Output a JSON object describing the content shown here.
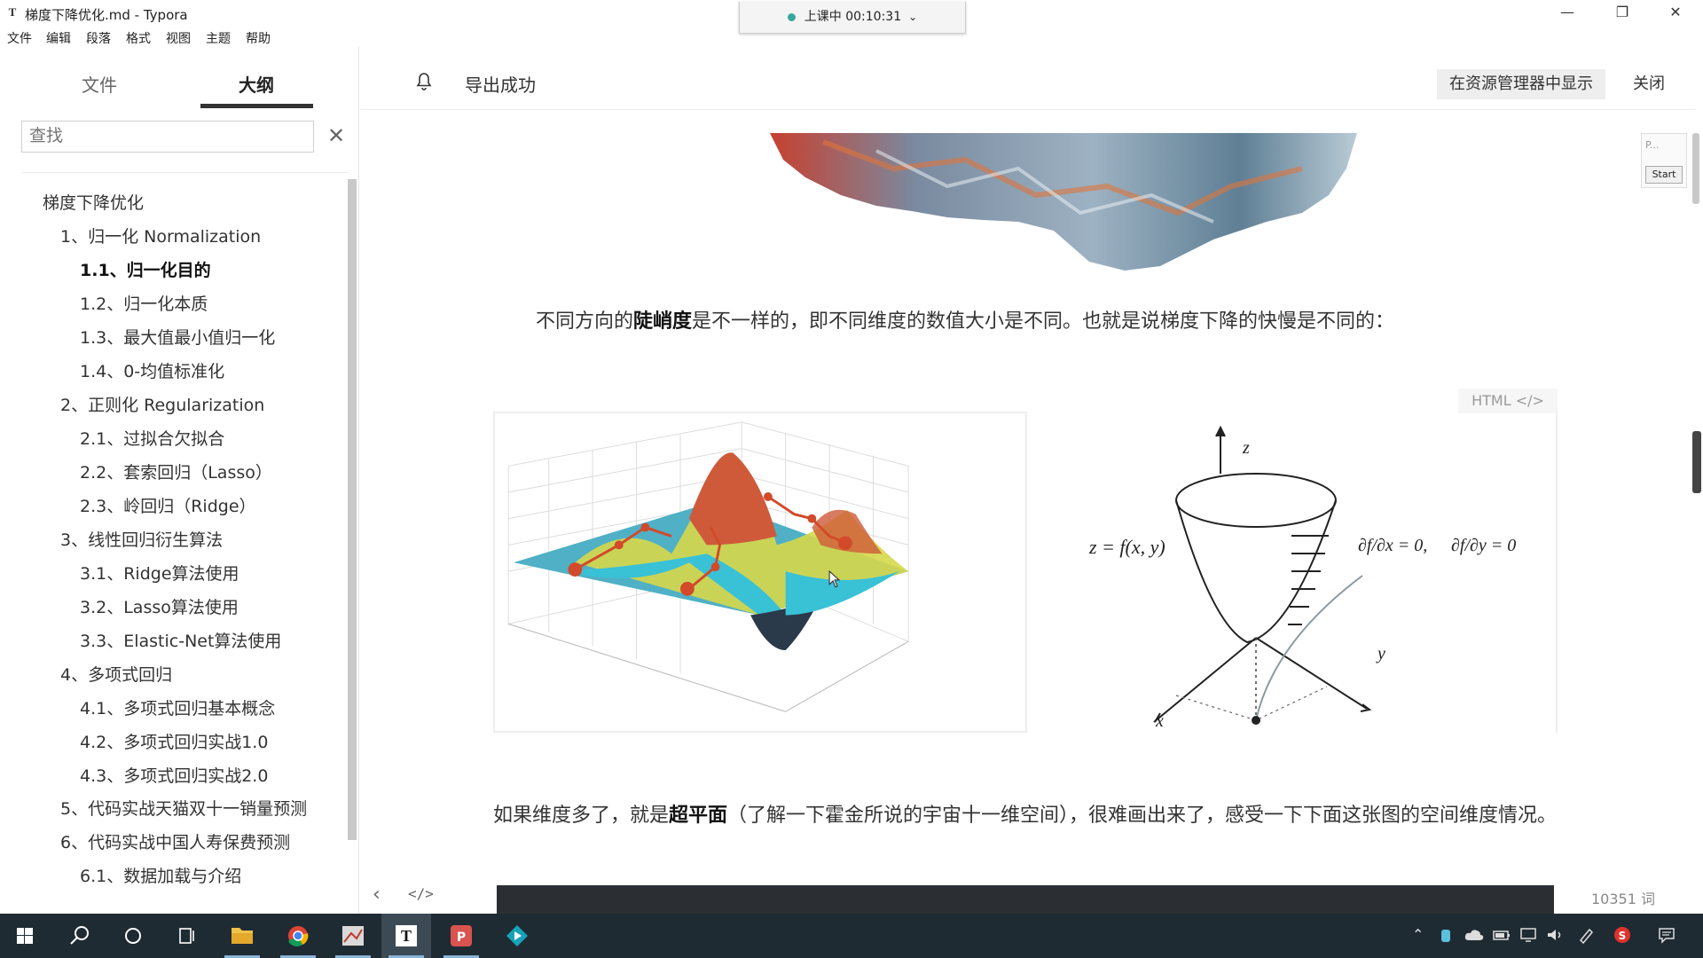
{
  "window": {
    "app_icon": "T",
    "title": "梯度下降优化.md - Typora",
    "minimize": "—",
    "maximize": "❐",
    "close": "✕"
  },
  "session": {
    "label": "上课中 00:10:31",
    "chevron": "⌄"
  },
  "menu": [
    "文件",
    "编辑",
    "段落",
    "格式",
    "视图",
    "主题",
    "帮助"
  ],
  "sidebar": {
    "tabs": [
      {
        "label": "文件"
      },
      {
        "label": "大纲"
      }
    ],
    "search_placeholder": "查找",
    "close_icon": "✕",
    "outline": [
      {
        "label": "梯度下降优化",
        "level": 1
      },
      {
        "label": "1、归一化 Normalization",
        "level": 2
      },
      {
        "label": "1.1、归一化目的",
        "level": 3,
        "active": true
      },
      {
        "label": "1.2、归一化本质",
        "level": 3
      },
      {
        "label": "1.3、最大值最小值归一化",
        "level": 3
      },
      {
        "label": "1.4、0-均值标准化",
        "level": 3
      },
      {
        "label": "2、正则化 Regularization",
        "level": 2
      },
      {
        "label": "2.1、过拟合欠拟合",
        "level": 3
      },
      {
        "label": "2.2、套索回归（Lasso）",
        "level": 3
      },
      {
        "label": "2.3、岭回归（Ridge）",
        "level": 3
      },
      {
        "label": "3、线性回归衍生算法",
        "level": 2
      },
      {
        "label": "3.1、Ridge算法使用",
        "level": 3
      },
      {
        "label": "3.2、Lasso算法使用",
        "level": 3
      },
      {
        "label": "3.3、Elastic-Net算法使用",
        "level": 3
      },
      {
        "label": "4、多项式回归",
        "level": 2
      },
      {
        "label": "4.1、多项式回归基本概念",
        "level": 3
      },
      {
        "label": "4.2、多项式回归实战1.0",
        "level": 3
      },
      {
        "label": "4.3、多项式回归实战2.0",
        "level": 3
      },
      {
        "label": "5、代码实战天猫双十一销量预测",
        "level": 2,
        "wrap": true
      },
      {
        "label": "6、代码实战中国人寿保费预测",
        "level": 2
      },
      {
        "label": "6.1、数据加载与介绍",
        "level": 3
      }
    ]
  },
  "notification": {
    "message": "导出成功",
    "show_in_explorer": "在资源管理器中显示",
    "close": "关闭"
  },
  "content": {
    "para1": {
      "before": "不同方向的",
      "bold": "陡峭度",
      "after": "是不一样的，即不同维度的数值大小是不同。也就是说梯度下降的快慢是不同的："
    },
    "html_tag": "HTML </>",
    "figure_right": {
      "formula_left": "z = f(x, y)",
      "partial_x": "∂f/∂x = 0,",
      "partial_y": "∂f/∂y = 0",
      "axis_z": "z",
      "axis_x": "x",
      "axis_y": "y"
    },
    "para2": {
      "before": "如果维度多了，就是",
      "bold": "超平面",
      "after": "（了解一下霍金所说的宇宙十一维空间），很难画出来了，感受一下下面这张图的空间维度情况。"
    }
  },
  "mini_panel": {
    "label": "P...",
    "start": "Start"
  },
  "status": {
    "back_icon": "‹",
    "code_icon": "</>",
    "word_count": "10351 词"
  },
  "taskbar": {
    "items": [
      "windows-start",
      "search",
      "cortana",
      "task-view",
      "file-explorer",
      "chrome",
      "paint",
      "typora",
      "wps",
      "media"
    ],
    "tray_icons": [
      "chevron-up",
      "app",
      "cloud",
      "battery",
      "network",
      "volume",
      "pen",
      "sogou",
      "notification"
    ]
  }
}
